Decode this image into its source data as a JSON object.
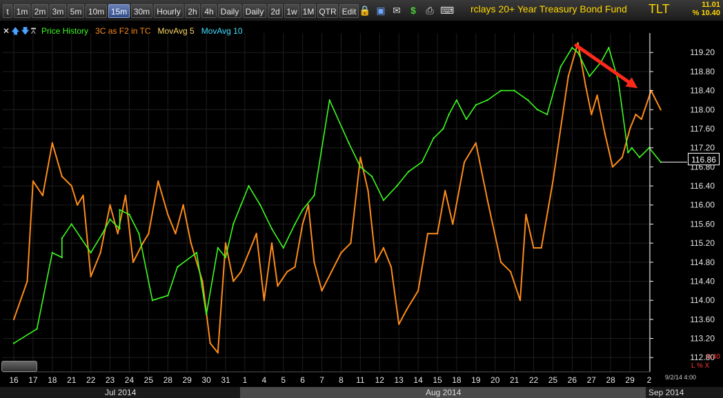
{
  "toolbar": {
    "timeframes": [
      {
        "label": "t",
        "active": false
      },
      {
        "label": "1m",
        "active": false
      },
      {
        "label": "2m",
        "active": false
      },
      {
        "label": "3m",
        "active": false
      },
      {
        "label": "5m",
        "active": false
      },
      {
        "label": "10m",
        "active": false
      },
      {
        "label": "15m",
        "active": true
      },
      {
        "label": "30m",
        "active": false
      },
      {
        "label": "Hourly",
        "active": false
      },
      {
        "label": "2h",
        "active": false
      },
      {
        "label": "4h",
        "active": false
      },
      {
        "label": "Daily",
        "active": false
      },
      {
        "label": "Daily",
        "active": false
      },
      {
        "label": "2d",
        "active": false
      },
      {
        "label": "1w",
        "active": false
      },
      {
        "label": "1M",
        "active": false
      },
      {
        "label": "QTR",
        "active": false
      },
      {
        "label": "Edit",
        "active": false
      }
    ],
    "icons": [
      "lock-icon",
      "save-icon",
      "mail-icon",
      "dollar-icon",
      "printer-icon",
      "keyboard-icon"
    ],
    "fund_name": "rclays 20+ Year Treasury Bond Fund",
    "ticker": "TLT",
    "last_price": "11.01",
    "pct_change": "% 10.40"
  },
  "legend": {
    "icons": [
      "close-icon",
      "arrow-up-icon",
      "arrow-down-icon",
      "pin-icon"
    ],
    "items": [
      {
        "label": "Price History",
        "color": "#3cff1e"
      },
      {
        "label": "3C as F2 in TC",
        "color": "#ff8c1a"
      },
      {
        "label": "MovAvg 5",
        "color": "#ffd966"
      },
      {
        "label": "MovAvg 10",
        "color": "#40e0ff"
      }
    ]
  },
  "current_price": "116.86",
  "indicator_value": "0.40",
  "indicator_scale": "L % X",
  "timestamp": "9/2/14 4:00",
  "months": {
    "jul": "Jul 2014",
    "aug": "Aug 2014",
    "sep": "Sep 2014"
  },
  "colors": {
    "price": "#3cff1e",
    "indicator": "#ff8c1a",
    "arrow": "#ff2a1a",
    "grid": "#1f1f1f",
    "axis": "#ffffff"
  },
  "chart_data": {
    "type": "line",
    "x_ticks": [
      "16",
      "17",
      "18",
      "21",
      "22",
      "23",
      "24",
      "25",
      "28",
      "29",
      "30",
      "31",
      "1",
      "4",
      "5",
      "6",
      "7",
      "8",
      "11",
      "12",
      "13",
      "14",
      "15",
      "18",
      "19",
      "20",
      "21",
      "22",
      "25",
      "26",
      "27",
      "28",
      "29",
      "2"
    ],
    "y_ticks": [
      112.8,
      113.2,
      113.6,
      114.0,
      114.4,
      114.8,
      115.2,
      115.6,
      116.0,
      116.4,
      116.8,
      117.2,
      117.6,
      118.0,
      118.4,
      118.8,
      119.2
    ],
    "ylim": [
      112.5,
      119.55
    ],
    "grid": true,
    "series": [
      {
        "name": "Price History",
        "color": "#3cff1e",
        "x": [
          0,
          1.2,
          2.0,
          2.5,
          2.5,
          3.0,
          3.5,
          4.0,
          4.6,
          5.0,
          5.5,
          5.5,
          6.0,
          6.5,
          7.2,
          8.0,
          8.5,
          9.5,
          10.0,
          10.6,
          11.0,
          11.4,
          11.8,
          12.2,
          12.8,
          13.4,
          14.0,
          14.6,
          15.0,
          15.6,
          16.4,
          17.4,
          18.0,
          18.6,
          19.2,
          19.9,
          20.5,
          21.2,
          21.8,
          22.3,
          22.6,
          23.0,
          23.5,
          24.0,
          24.6,
          25.3,
          26.0,
          26.7,
          27.2,
          27.7,
          28.4,
          29.0,
          29.3,
          29.9,
          30.5,
          30.9,
          31.4,
          31.9,
          32.1,
          32.5,
          33.0,
          33.6
        ],
        "y": [
          113.1,
          113.4,
          115.0,
          114.9,
          115.3,
          115.6,
          115.3,
          115.0,
          115.4,
          115.7,
          115.5,
          115.9,
          115.8,
          115.4,
          114.0,
          114.1,
          114.7,
          115.0,
          113.7,
          115.1,
          114.9,
          115.6,
          116.0,
          116.4,
          116.0,
          115.5,
          115.1,
          115.6,
          115.9,
          116.2,
          118.2,
          117.3,
          116.8,
          116.6,
          116.1,
          116.4,
          116.7,
          116.9,
          117.4,
          117.6,
          117.9,
          118.2,
          117.8,
          118.1,
          118.2,
          118.4,
          118.4,
          118.2,
          118.0,
          117.9,
          118.9,
          119.3,
          119.2,
          118.7,
          119.0,
          119.3,
          118.6,
          117.1,
          117.2,
          117.0,
          117.2,
          116.9
        ]
      },
      {
        "name": "3C as F2 in TC",
        "color": "#ff8c1a",
        "x": [
          0,
          0.7,
          1.0,
          1.5,
          2.0,
          2.5,
          3.0,
          3.3,
          3.6,
          4.0,
          4.5,
          5.0,
          5.4,
          5.8,
          6.2,
          6.7,
          7.0,
          7.5,
          8.0,
          8.4,
          8.8,
          9.2,
          9.8,
          10.2,
          10.6,
          11.0,
          11.4,
          11.8,
          12.2,
          12.6,
          13.0,
          13.4,
          13.7,
          14.2,
          14.6,
          15.0,
          15.3,
          15.6,
          16.0,
          16.5,
          17.0,
          17.5,
          18.0,
          18.4,
          18.8,
          19.2,
          19.6,
          20.0,
          20.4,
          21.0,
          21.5,
          22.0,
          22.4,
          22.8,
          23.4,
          24.0,
          24.6,
          25.3,
          25.8,
          26.3,
          26.6,
          27.0,
          27.4,
          28.0,
          28.4,
          28.8,
          29.3,
          29.7,
          30.0,
          30.3,
          30.7,
          31.1,
          31.6,
          32.0,
          32.3,
          32.6,
          33.1,
          33.6
        ],
        "y": [
          113.6,
          114.4,
          116.5,
          116.2,
          117.3,
          116.6,
          116.4,
          116.0,
          116.2,
          114.5,
          115.0,
          116.0,
          115.4,
          116.2,
          114.8,
          115.2,
          115.4,
          116.5,
          115.8,
          115.4,
          116.0,
          115.2,
          114.4,
          113.1,
          112.9,
          115.2,
          114.4,
          114.6,
          115.0,
          115.4,
          114.0,
          115.2,
          114.3,
          114.6,
          114.7,
          115.6,
          116.0,
          114.8,
          114.2,
          114.6,
          115.0,
          115.2,
          117.0,
          116.3,
          114.8,
          115.1,
          114.7,
          113.5,
          113.8,
          114.2,
          115.4,
          115.4,
          116.3,
          115.6,
          116.9,
          117.3,
          116.1,
          114.8,
          114.6,
          114.0,
          115.8,
          115.1,
          115.1,
          116.5,
          117.6,
          118.7,
          119.4,
          118.5,
          117.9,
          118.3,
          117.5,
          116.8,
          117.0,
          117.6,
          117.9,
          117.8,
          118.4,
          118.0
        ]
      }
    ],
    "annotations": [
      {
        "type": "arrow",
        "color": "#ff2a1a",
        "from": {
          "x": 29.2,
          "y": 119.35
        },
        "to": {
          "x": 32.4,
          "y": 118.45
        }
      }
    ]
  }
}
